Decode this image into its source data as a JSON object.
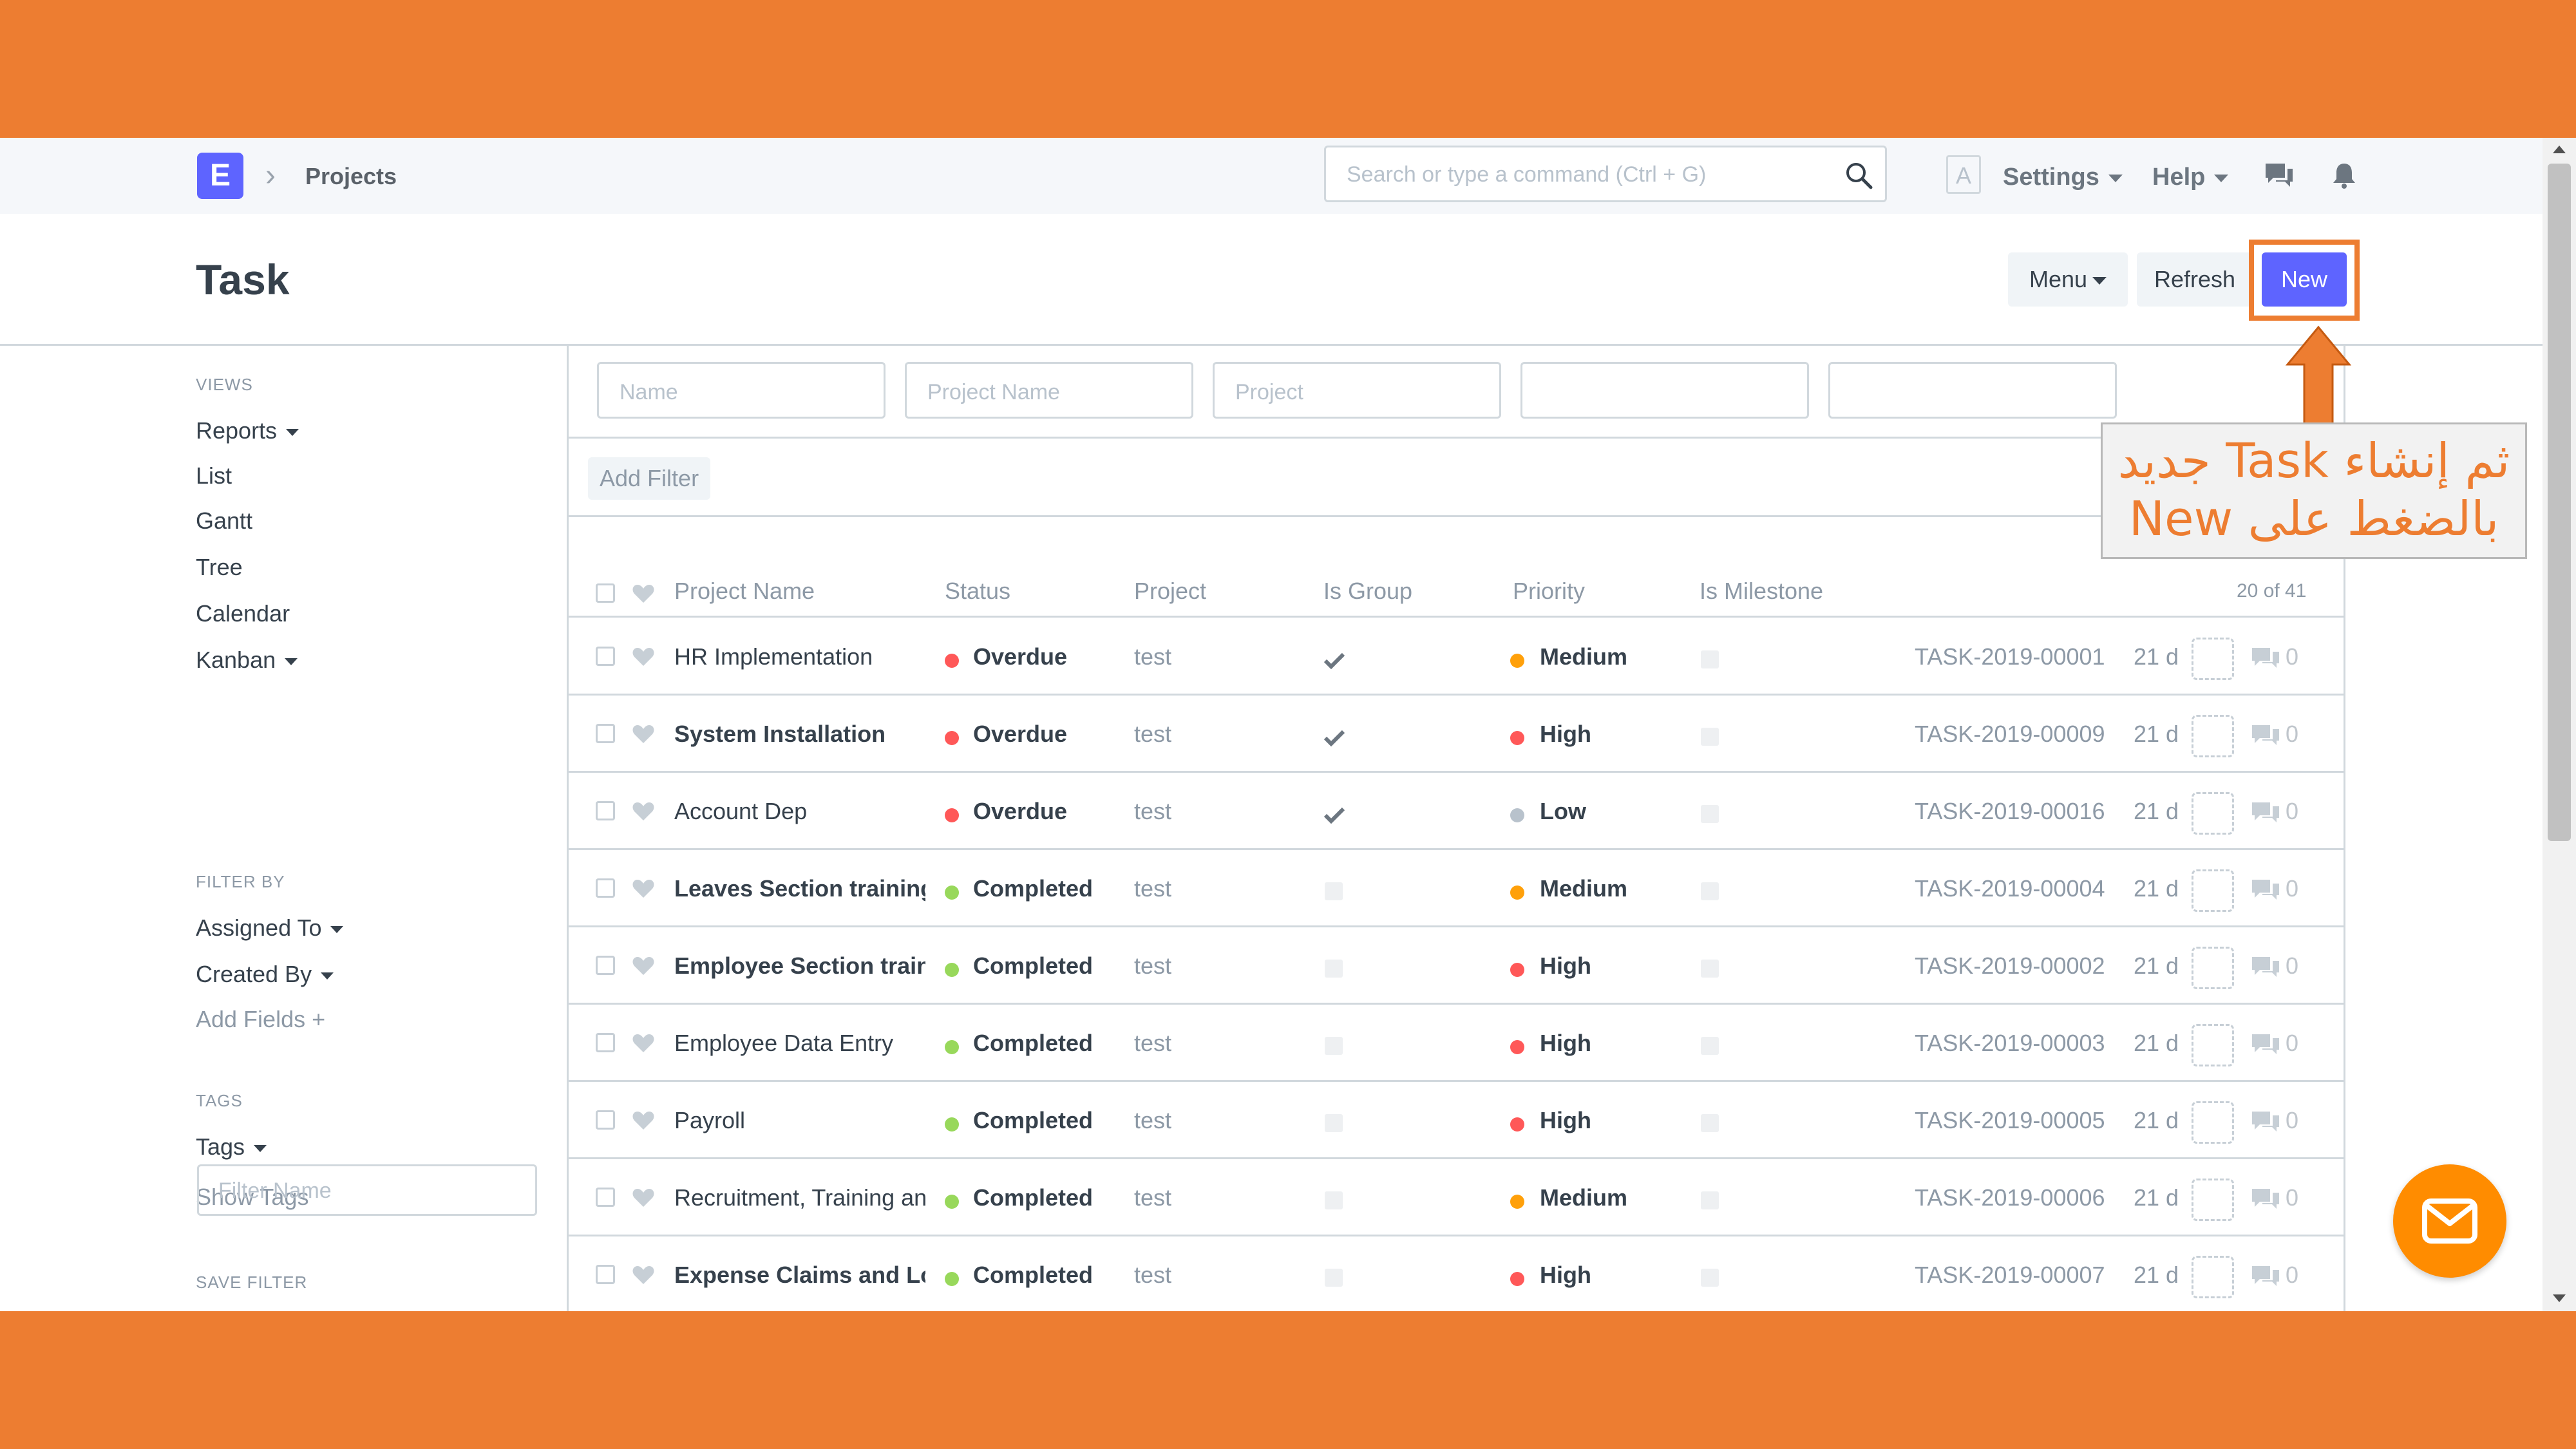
{
  "navbar": {
    "logo_letter": "E",
    "breadcrumb": "Projects",
    "search_placeholder": "Search or type a command (Ctrl + G)",
    "avatar_letter": "A",
    "settings_label": "Settings",
    "help_label": "Help"
  },
  "page": {
    "title": "Task",
    "menu_label": "Menu",
    "refresh_label": "Refresh",
    "new_label": "New"
  },
  "sidebar": {
    "views_heading": "VIEWS",
    "views": [
      "Reports",
      "List",
      "Gantt",
      "Tree",
      "Calendar",
      "Kanban"
    ],
    "filter_heading": "FILTER BY",
    "filters": [
      "Assigned To",
      "Created By"
    ],
    "add_fields": "Add Fields",
    "tags_heading": "TAGS",
    "tags_label": "Tags",
    "show_tags": "Show Tags",
    "save_filter_heading": "SAVE FILTER",
    "filter_name_placeholder": "Filter Name"
  },
  "filters": {
    "name_placeholder": "Name",
    "project_name_placeholder": "Project Name",
    "project_placeholder": "Project",
    "add_filter": "Add Filter"
  },
  "table": {
    "headers": [
      "Project Name",
      "Status",
      "Project",
      "Is Group",
      "Priority",
      "Is Milestone"
    ],
    "count_label": "20 of 41",
    "rows": [
      {
        "name": "HR Implementation",
        "bold": false,
        "status": "Overdue",
        "project": "test",
        "is_group": true,
        "priority": "Medium",
        "id": "TASK-2019-00001",
        "age": "21 d",
        "comments": "0"
      },
      {
        "name": "System Installation",
        "bold": true,
        "status": "Overdue",
        "project": "test",
        "is_group": true,
        "priority": "High",
        "id": "TASK-2019-00009",
        "age": "21 d",
        "comments": "0"
      },
      {
        "name": "Account Dep",
        "bold": false,
        "status": "Overdue",
        "project": "test",
        "is_group": true,
        "priority": "Low",
        "id": "TASK-2019-00016",
        "age": "21 d",
        "comments": "0"
      },
      {
        "name": "Leaves Section training",
        "bold": true,
        "status": "Completed",
        "project": "test",
        "is_group": false,
        "priority": "Medium",
        "id": "TASK-2019-00004",
        "age": "21 d",
        "comments": "0"
      },
      {
        "name": "Employee Section train",
        "bold": true,
        "status": "Completed",
        "project": "test",
        "is_group": false,
        "priority": "High",
        "id": "TASK-2019-00002",
        "age": "21 d",
        "comments": "0"
      },
      {
        "name": "Employee Data Entry",
        "bold": false,
        "status": "Completed",
        "project": "test",
        "is_group": false,
        "priority": "High",
        "id": "TASK-2019-00003",
        "age": "21 d",
        "comments": "0"
      },
      {
        "name": "Payroll",
        "bold": false,
        "status": "Completed",
        "project": "test",
        "is_group": false,
        "priority": "High",
        "id": "TASK-2019-00005",
        "age": "21 d",
        "comments": "0"
      },
      {
        "name": "Recruitment, Training and",
        "bold": false,
        "status": "Completed",
        "project": "test",
        "is_group": false,
        "priority": "Medium",
        "id": "TASK-2019-00006",
        "age": "21 d",
        "comments": "0"
      },
      {
        "name": "Expense Claims and Loans",
        "bold": true,
        "status": "Completed",
        "project": "test",
        "is_group": false,
        "priority": "High",
        "id": "TASK-2019-00007",
        "age": "21 d",
        "comments": "0"
      }
    ]
  },
  "colors": {
    "frame": "#ed7d31",
    "primary": "#5e64ff",
    "overdue": "#ff5858",
    "completed": "#98d85b",
    "medium": "#ffa00a",
    "high": "#ff5858",
    "low": "#b8c2cc"
  },
  "annotation": {
    "line1": "ثم إنشاء Task جديد",
    "line2": "بالضغط على New"
  },
  "icons": {
    "search": "search-icon",
    "chat": "chat-icon",
    "bell": "bell-icon",
    "heart": "heart-icon",
    "check": "check-icon",
    "comment": "comment-icon",
    "mail": "mail-icon"
  }
}
